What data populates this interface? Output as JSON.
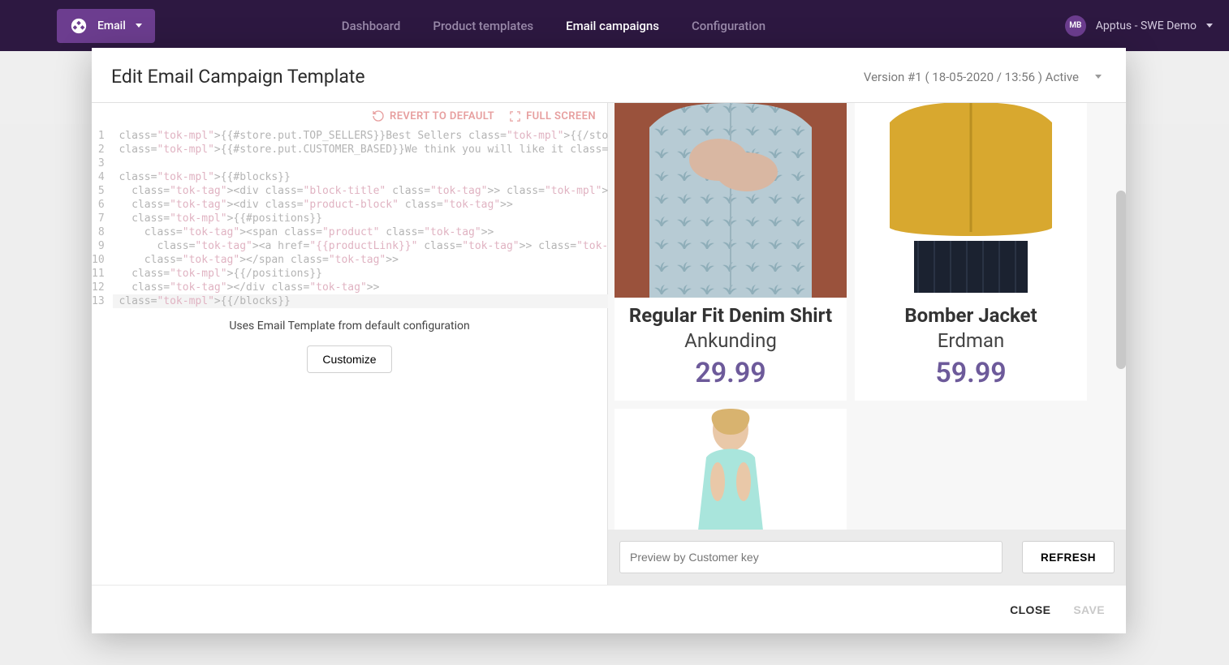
{
  "topbar": {
    "email_label": "Email",
    "nav": [
      {
        "label": "Dashboard",
        "active": false
      },
      {
        "label": "Product templates",
        "active": false
      },
      {
        "label": "Email campaigns",
        "active": true
      },
      {
        "label": "Configuration",
        "active": false
      }
    ],
    "user_initials": "MB",
    "user_label": "Apptus - SWE Demo"
  },
  "modal": {
    "title": "Edit Email Campaign Template",
    "version_label": "Version #1 ( 18-05-2020 / 13:56 ) Active",
    "revert_label": "REVERT TO DEFAULT",
    "fullscreen_label": "FULL SCREEN",
    "config_note": "Uses Email Template from default configuration",
    "customize_label": "Customize",
    "preview_placeholder": "Preview by Customer key",
    "refresh_label": "REFRESH",
    "close_label": "CLOSE",
    "save_label": "SAVE"
  },
  "code": {
    "lines": [
      "{{#store.put.TOP_SELLERS}}Best Sellers{{/store.put.TOP_SELLERS}}",
      "{{#store.put.CUSTOMER_BASED}}We think you will like it{{/store.put.CUSTOMER_BASED}}",
      "",
      "{{#blocks}}",
      "  <div class=\"block-title\">{{#store.byName}}{{type}}{{/store.byName}}</div>",
      "  <div class=\"product-block\">",
      "  {{#positions}}",
      "    <span class=\"product\">",
      "      <a href=\"{{productLink}}\"><img src=\"{{productImage}}\"/></a>",
      "    </span>",
      "  {{/positions}}",
      "  </div>",
      "{{/blocks}}"
    ]
  },
  "products": [
    {
      "title": "Regular Fit Denim Shirt",
      "brand": "Ankunding",
      "price": "29.99",
      "img_bg": "#9a523c",
      "img_kind": "shirt"
    },
    {
      "title": "Bomber Jacket",
      "brand": "Erdman",
      "price": "59.99",
      "img_bg": "#ffffff",
      "img_kind": "jacket"
    },
    {
      "title": "",
      "brand": "",
      "price": "",
      "img_bg": "#ffffff",
      "img_kind": "tank"
    }
  ]
}
